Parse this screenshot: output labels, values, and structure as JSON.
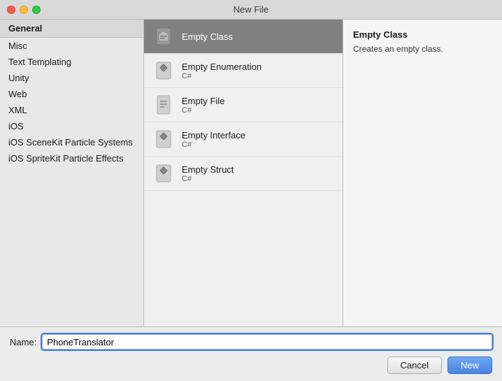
{
  "window": {
    "title": "New File"
  },
  "left_panel": {
    "header": "General",
    "items": [
      {
        "id": "misc",
        "label": "Misc"
      },
      {
        "id": "text-templating",
        "label": "Text Templating"
      },
      {
        "id": "unity",
        "label": "Unity"
      },
      {
        "id": "web",
        "label": "Web"
      },
      {
        "id": "xml",
        "label": "XML"
      },
      {
        "id": "ios",
        "label": "iOS"
      },
      {
        "id": "ios-scenekit",
        "label": "iOS SceneKit Particle Systems"
      },
      {
        "id": "ios-spritekit",
        "label": "iOS SpriteKit Particle Effects"
      }
    ]
  },
  "middle_panel": {
    "items": [
      {
        "id": "empty-class",
        "label": "Empty Class",
        "subtitle": "",
        "selected": true
      },
      {
        "id": "empty-enumeration",
        "label": "Empty Enumeration",
        "subtitle": "C#"
      },
      {
        "id": "empty-file",
        "label": "Empty File",
        "subtitle": "C#"
      },
      {
        "id": "empty-interface",
        "label": "Empty Interface",
        "subtitle": "C#"
      },
      {
        "id": "empty-struct",
        "label": "Empty Struct",
        "subtitle": "C#"
      }
    ]
  },
  "right_panel": {
    "title": "Empty Class",
    "description": "Creates an empty class."
  },
  "bottom": {
    "name_label": "Name:",
    "name_value": "PhoneTranslator",
    "cancel_label": "Cancel",
    "new_label": "New"
  }
}
